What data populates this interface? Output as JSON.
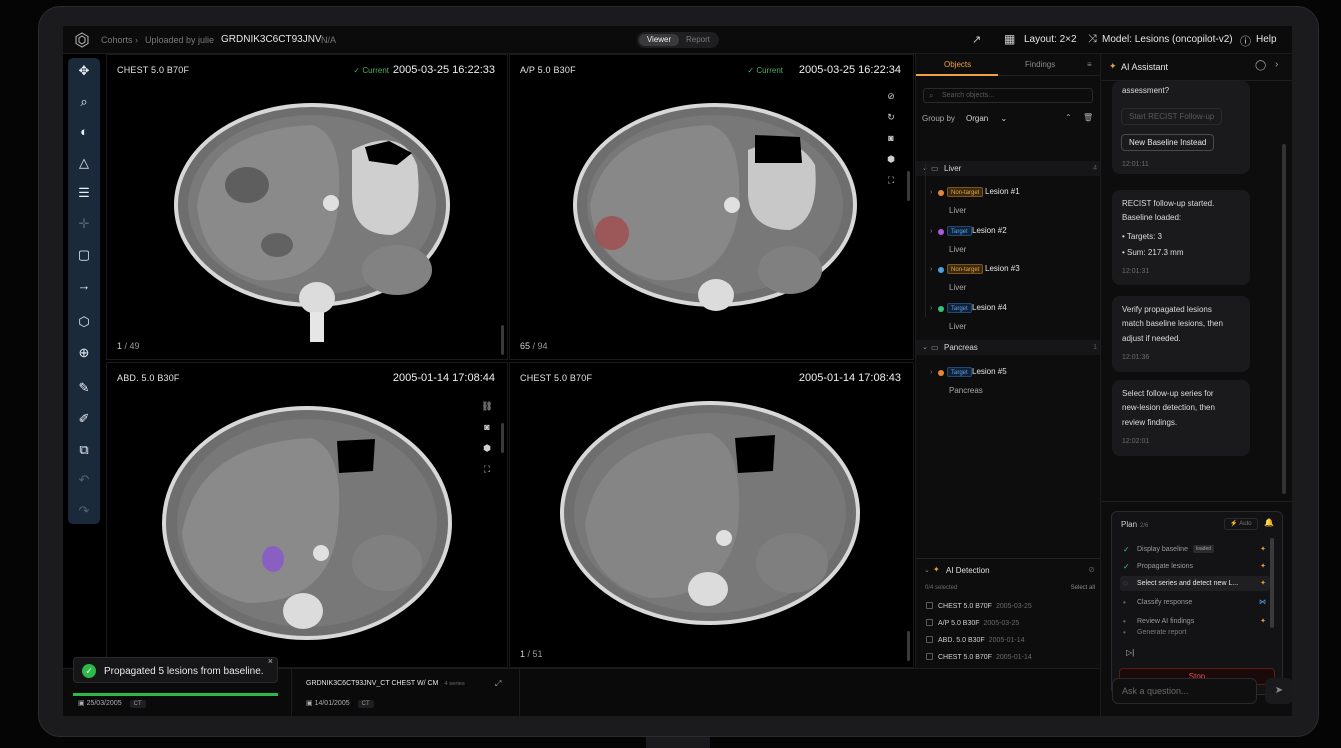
{
  "topbar": {
    "breadcrumb_root": "Cohorts",
    "breadcrumb_sep": "›",
    "breadcrumb_uploader": "Uploaded by julie",
    "study_id": "GRDNIK3C6CT93JNV",
    "study_status": "N/A",
    "tab_viewer": "Viewer",
    "tab_report": "Report",
    "layout_label": "Layout: 2×2",
    "model_label": "Model: Lesions (oncopilot-v2)",
    "help_label": "Help"
  },
  "viewports": [
    {
      "title": "CHEST 5.0 B70F",
      "current": "Current",
      "date": "2005-03-25 16:22:33",
      "slice": "1",
      "total": "/ 49"
    },
    {
      "title": "A/P 5.0 B30F",
      "current": "Current",
      "date": "2005-03-25 16:22:34",
      "slice": "65",
      "total": "/ 94"
    },
    {
      "title": "ABD. 5.0 B30F",
      "current": "",
      "date": "2005-01-14 17:08:44",
      "slice": "",
      "total": ""
    },
    {
      "title": "CHEST 5.0 B70F",
      "current": "",
      "date": "2005-01-14 17:08:43",
      "slice": "1",
      "total": "/ 51"
    }
  ],
  "objects": {
    "tab_objects": "Objects",
    "tab_findings": "Findings",
    "search_placeholder": "Search objects...",
    "group_by_label": "Group by",
    "group_by_value": "Organ",
    "groups": [
      {
        "name": "Liver",
        "count": "4"
      },
      {
        "name": "Pancreas",
        "count": "1"
      }
    ],
    "lesions": [
      {
        "badge": "Non-target",
        "name": "Lesion #1",
        "organ": "Liver",
        "color": "#e8843a"
      },
      {
        "badge": "Target",
        "name": "Lesion #2",
        "organ": "Liver",
        "color": "#b05ae0"
      },
      {
        "badge": "Non-target",
        "name": "Lesion #3",
        "organ": "Liver",
        "color": "#4aa0e0"
      },
      {
        "badge": "Target",
        "name": "Lesion #4",
        "organ": "Liver",
        "color": "#3ac07a"
      },
      {
        "badge": "Target",
        "name": "Lesion #5",
        "organ": "Pancreas",
        "color": "#e8843a"
      }
    ],
    "ai_detection": {
      "title": "AI Detection",
      "selected": "0/4 selected",
      "select_all": "Select all",
      "items": [
        {
          "series": "CHEST 5.0 B70F",
          "date": "2005-03-25"
        },
        {
          "series": "A/P 5.0 B30F",
          "date": "2005-03-25"
        },
        {
          "series": "ABD. 5.0 B30F",
          "date": "2005-01-14"
        },
        {
          "series": "CHEST 5.0 B70F",
          "date": "2005-01-14"
        }
      ]
    }
  },
  "assistant": {
    "title": "AI Assistant",
    "msg1": {
      "text": "assessment?",
      "btn_disabled": "Start RECIST Follow-up",
      "btn_enabled": "New Baseline Instead",
      "time": "12:01:11"
    },
    "msg2": {
      "line1": "RECIST follow-up started.",
      "line2": "Baseline loaded:",
      "bullet1": "•  Targets: 3",
      "bullet2": "•  Sum: 217.3 mm",
      "time": "12:01:31"
    },
    "msg3": {
      "line1": "Verify propagated lesions",
      "line2": "match baseline lesions, then",
      "line3": "adjust if needed.",
      "time": "12:01:36"
    },
    "msg4": {
      "line1": "Select follow-up series for",
      "line2": "new-lesion detection, then",
      "line3": "review findings.",
      "time": "12:02:01"
    },
    "plan": {
      "title": "Plan",
      "progress": "2/6",
      "auto": "Auto",
      "steps": [
        {
          "label": "Display baseline",
          "tag": "loaded",
          "state": "done"
        },
        {
          "label": "Propagate lesions",
          "tag": "",
          "state": "done"
        },
        {
          "label": "Select series and detect new L...",
          "tag": "",
          "state": "active"
        },
        {
          "label": "Classify response",
          "tag": "",
          "state": "pending"
        },
        {
          "label": "Review AI findings",
          "tag": "",
          "state": "pending"
        },
        {
          "label": "Generate report",
          "tag": "",
          "state": "pending"
        }
      ],
      "stop": "Stop"
    },
    "ask_placeholder": "Ask a question..."
  },
  "bottom": {
    "card1": {
      "date": "25/03/2005",
      "modality": "CT"
    },
    "card2": {
      "title": "GRDNIK3C6CT93JNV_CT CHEST W/ CM",
      "series": "4 series",
      "date": "14/01/2005",
      "modality": "CT"
    }
  },
  "toast": {
    "text": "Propagated 5 lesions from baseline.",
    "progress": 1.0
  }
}
